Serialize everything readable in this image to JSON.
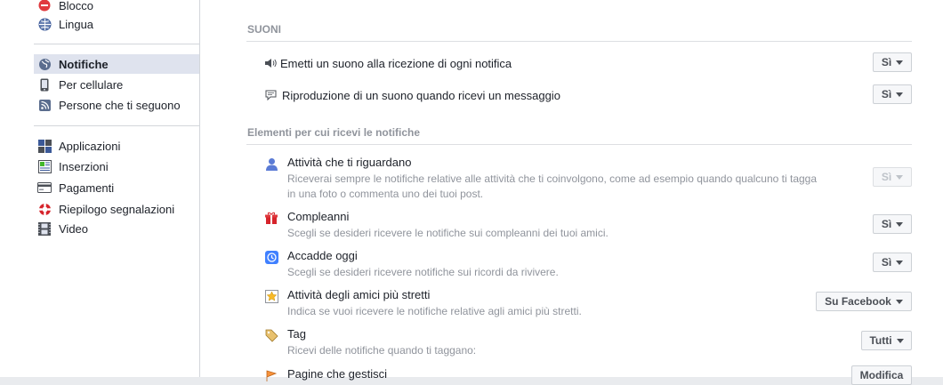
{
  "sidebar": {
    "items": [
      {
        "label": "Blocco",
        "icon": "block-icon"
      },
      {
        "label": "Lingua",
        "icon": "globe-icon"
      },
      {
        "label": "Notifiche",
        "icon": "globe-notification-icon",
        "active": true
      },
      {
        "label": "Per cellulare",
        "icon": "mobile-icon"
      },
      {
        "label": "Persone che ti seguono",
        "icon": "rss-icon"
      },
      {
        "label": "Applicazioni",
        "icon": "apps-icon"
      },
      {
        "label": "Inserzioni",
        "icon": "ads-icon"
      },
      {
        "label": "Pagamenti",
        "icon": "credit-card-icon"
      },
      {
        "label": "Riepilogo segnalazioni",
        "icon": "lifebuoy-icon"
      },
      {
        "label": "Video",
        "icon": "film-icon"
      }
    ]
  },
  "sounds": {
    "title": "SUONI",
    "rows": [
      {
        "label": "Emetti un suono alla ricezione di ogni notifica",
        "icon": "speaker-icon",
        "value": "Sì"
      },
      {
        "label": "Riproduzione di un suono quando ricevi un messaggio",
        "icon": "message-icon",
        "value": "Sì"
      }
    ]
  },
  "elements": {
    "title": "Elementi per cui ricevi le notifiche",
    "items": [
      {
        "title": "Attività che ti riguardano",
        "desc": "Riceverai sempre le notifiche relative alle attività che ti coinvolgono, come ad esempio quando qualcuno ti tagga in una foto o commenta uno dei tuoi post.",
        "icon": "person-icon",
        "value": "Sì",
        "disabled": true
      },
      {
        "title": "Compleanni",
        "desc": "Scegli se desideri ricevere le notifiche sui compleanni dei tuoi amici.",
        "icon": "gift-icon",
        "value": "Sì"
      },
      {
        "title": "Accadde oggi",
        "desc": "Scegli se desideri ricevere notifiche sui ricordi da rivivere.",
        "icon": "memories-icon",
        "value": "Sì"
      },
      {
        "title": "Attività degli amici più stretti",
        "desc": "Indica se vuoi ricevere le notifiche relative agli amici più stretti.",
        "icon": "star-icon",
        "value": "Su Facebook"
      },
      {
        "title": "Tag",
        "desc": "Ricevi delle notifiche quando ti taggano:",
        "icon": "tag-icon",
        "value": "Tutti"
      },
      {
        "title": "Pagine che gestisci",
        "desc": "",
        "icon": "pages-icon",
        "value": "Modifica"
      }
    ]
  },
  "colors": {
    "accent": "#3b5998",
    "active_bg": "#dfe3ee"
  }
}
